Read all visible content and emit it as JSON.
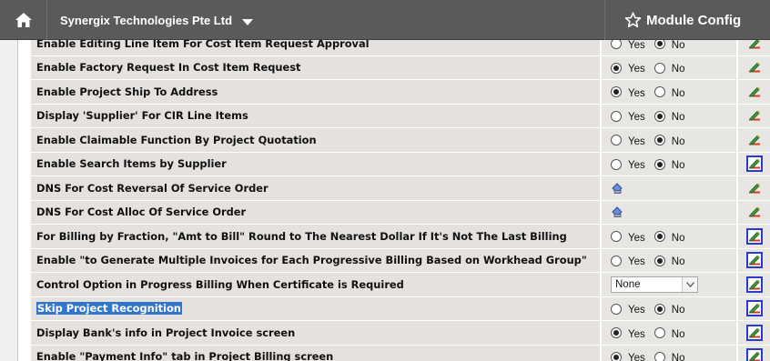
{
  "header": {
    "home_icon": "home-icon",
    "company": "Synergix Technologies Pte Ltd",
    "module_label": "Module Config",
    "module_icon": "star-outline-icon"
  },
  "radio_labels": {
    "yes": "Yes",
    "no": "No"
  },
  "rows": [
    {
      "label": "Enable Editing Line Item For Cost Item Request Approval",
      "control": "radio",
      "selected": "no",
      "edit_style": "plain"
    },
    {
      "label": "Enable Factory Request In Cost Item Request",
      "control": "radio",
      "selected": "yes",
      "edit_style": "plain"
    },
    {
      "label": "Enable Project Ship To Address",
      "control": "radio",
      "selected": "yes",
      "edit_style": "plain"
    },
    {
      "label": "Display 'Supplier' For CIR Line Items",
      "control": "radio",
      "selected": "no",
      "edit_style": "plain"
    },
    {
      "label": "Enable Claimable Function By Project Quotation",
      "control": "radio",
      "selected": "no",
      "edit_style": "plain"
    },
    {
      "label": "Enable Search Items by Supplier",
      "control": "radio",
      "selected": "no",
      "edit_style": "boxed"
    },
    {
      "label": "DNS For Cost Reversal Of Service Order",
      "control": "lookup",
      "selected": null,
      "edit_style": "plain"
    },
    {
      "label": "DNS For Cost Alloc Of Service Order",
      "control": "lookup",
      "selected": null,
      "edit_style": "plain"
    },
    {
      "label": "For Billing by Fraction, \"Amt to Bill\" Round to The Nearest Dollar If It's Not The Last Billing",
      "control": "radio",
      "selected": "no",
      "edit_style": "boxed"
    },
    {
      "label": "Enable \"to Generate Multiple Invoices for Each Progressive Billing Based on Workhead Group\"",
      "control": "radio",
      "selected": "no",
      "edit_style": "boxed"
    },
    {
      "label": "Control Option in Progress Billing When Certificate is Required",
      "control": "dropdown",
      "value": "None",
      "edit_style": "boxed"
    },
    {
      "label": "Skip Project Recognition",
      "control": "radio",
      "selected": "no",
      "edit_style": "boxed",
      "highlighted": true
    },
    {
      "label": "Display Bank's info in Project Invoice screen",
      "control": "radio",
      "selected": "yes",
      "edit_style": "boxed"
    },
    {
      "label": "Enable \"Payment Info\" tab in Project Billing screen",
      "control": "radio",
      "selected": "yes",
      "edit_style": "boxed"
    }
  ],
  "colors": {
    "topbar": "#5a5a5a",
    "row_bg": "#e4e1de",
    "selection": "#3376c9",
    "edit_border": "#2a3cd0"
  }
}
